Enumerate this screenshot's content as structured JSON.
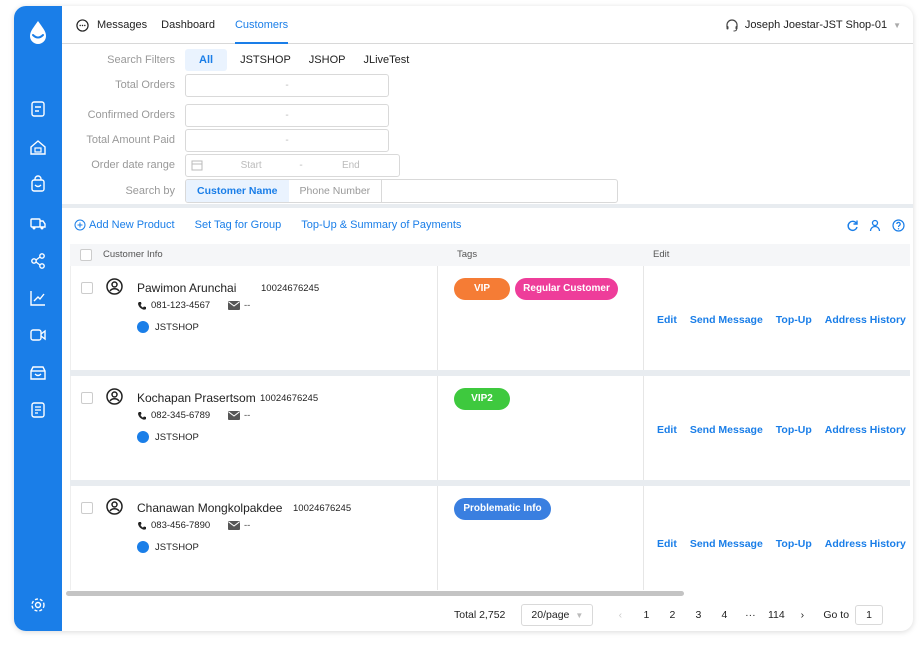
{
  "topbar": {
    "tabs": [
      {
        "label": "Messages"
      },
      {
        "label": "Dashboard"
      },
      {
        "label": "Customers"
      }
    ],
    "active_tab": "Customers",
    "user": "Joseph Joestar-JST Shop-01"
  },
  "filters": {
    "search_filters_label": "Search Filters",
    "shops": [
      "All",
      "JSTSHOP",
      "JSHOP",
      "JLiveTest"
    ],
    "total_orders_label": "Total Orders",
    "confirmed_orders_label": "Confirmed Orders",
    "total_amount_label": "Total Amount Paid",
    "range_sep": "-",
    "date_range_label": "Order date range",
    "date_start": "Start",
    "date_sep": "-",
    "date_end": "End",
    "search_by_label": "Search by",
    "search_by_options": [
      "Customer Name",
      "Phone Number"
    ]
  },
  "actions": {
    "add_product": "Add New Product",
    "set_tag": "Set Tag for Group",
    "topup_summary": "Top-Up & Summary of Payments"
  },
  "table": {
    "headers": {
      "customer_info": "Customer Info",
      "tags": "Tags",
      "edit": "Edit"
    },
    "edit_actions": [
      "Edit",
      "Send Message",
      "Top-Up",
      "Address History"
    ],
    "rows": [
      {
        "name": "Pawimon Arunchai",
        "id": "10024676245",
        "phone": "081-123-4567",
        "email": "--",
        "shop": "JSTSHOP",
        "tags": [
          {
            "label": "VIP",
            "color": "#f57c35"
          },
          {
            "label": "Regular Customer",
            "color": "#ee3d9a"
          }
        ]
      },
      {
        "name": "Kochapan Prasertsom",
        "id": "10024676245",
        "phone": "082-345-6789",
        "email": "--",
        "shop": "JSTSHOP",
        "tags": [
          {
            "label": "VIP2",
            "color": "#3ec93e"
          }
        ]
      },
      {
        "name": "Chanawan Mongkolpakdee",
        "id": "10024676245",
        "phone": "083-456-7890",
        "email": "--",
        "shop": "JSTSHOP",
        "tags": [
          {
            "label": "Problematic Info",
            "color": "#3a7fe0"
          }
        ]
      }
    ]
  },
  "pager": {
    "total": "Total 2,752",
    "page_size": "20/page",
    "pages": [
      "1",
      "2",
      "3",
      "4",
      "···",
      "114"
    ],
    "goto_label": "Go to",
    "goto_value": "1"
  },
  "colors": {
    "accent": "#1a7ee8"
  }
}
